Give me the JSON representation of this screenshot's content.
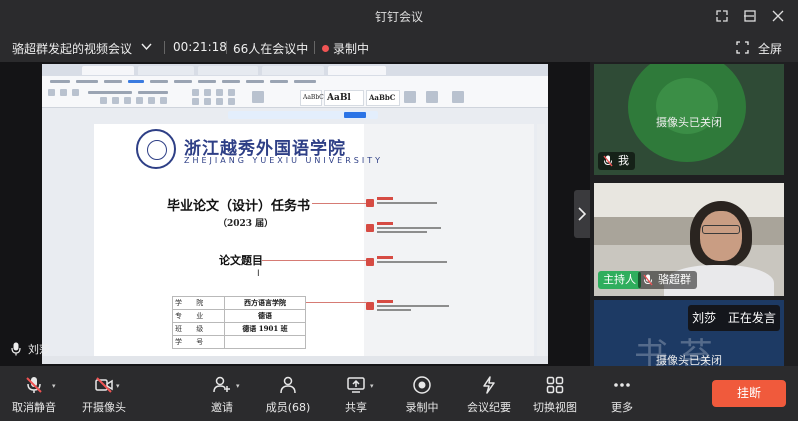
{
  "window": {
    "title": "钉钉会议"
  },
  "meeting": {
    "name": "骆超群发起的视频会议",
    "duration": "00:21:18",
    "attendees": "66人在会议中",
    "recording": "录制中",
    "fullscreen_label": "全屏"
  },
  "document": {
    "school_cn": "浙江越秀外国语学院",
    "school_en": "ZHEJIANG YUEXIU UNIVERSITY",
    "title": "毕业论文（设计）任务书",
    "year": "（2023 届）",
    "topic_label": "论文题目",
    "table": [
      {
        "key": "学  院",
        "value": "西方语言学院"
      },
      {
        "key": "专  业",
        "value": "德语"
      },
      {
        "key": "班  级",
        "value": "德语 1901 班"
      },
      {
        "key": "学  号",
        "value": ""
      }
    ]
  },
  "shared_screen": {
    "speaker_name": "刘莎"
  },
  "participants": [
    {
      "tile": "self",
      "camera_status": "摄像头已关闭",
      "name": "我"
    },
    {
      "tile": "host",
      "role": "主持人",
      "name": "骆超群"
    },
    {
      "tile": "speaker",
      "name": "刘莎",
      "status": "正在发言",
      "camera_status": "摄像头已关闭",
      "bg_text": "书 苔"
    }
  ],
  "toolbar": {
    "mute": "取消静音",
    "camera": "开摄像头",
    "invite": "邀请",
    "members": "成员(68)",
    "share": "共享",
    "record": "录制中",
    "minutes": "会议纪要",
    "layout": "切换视图",
    "more": "更多",
    "hangup": "挂断"
  },
  "colors": {
    "accent_red": "#f05a3c",
    "host_green": "#2fae5d",
    "record_red": "#f05454",
    "doc_blue": "#2e3f86"
  }
}
